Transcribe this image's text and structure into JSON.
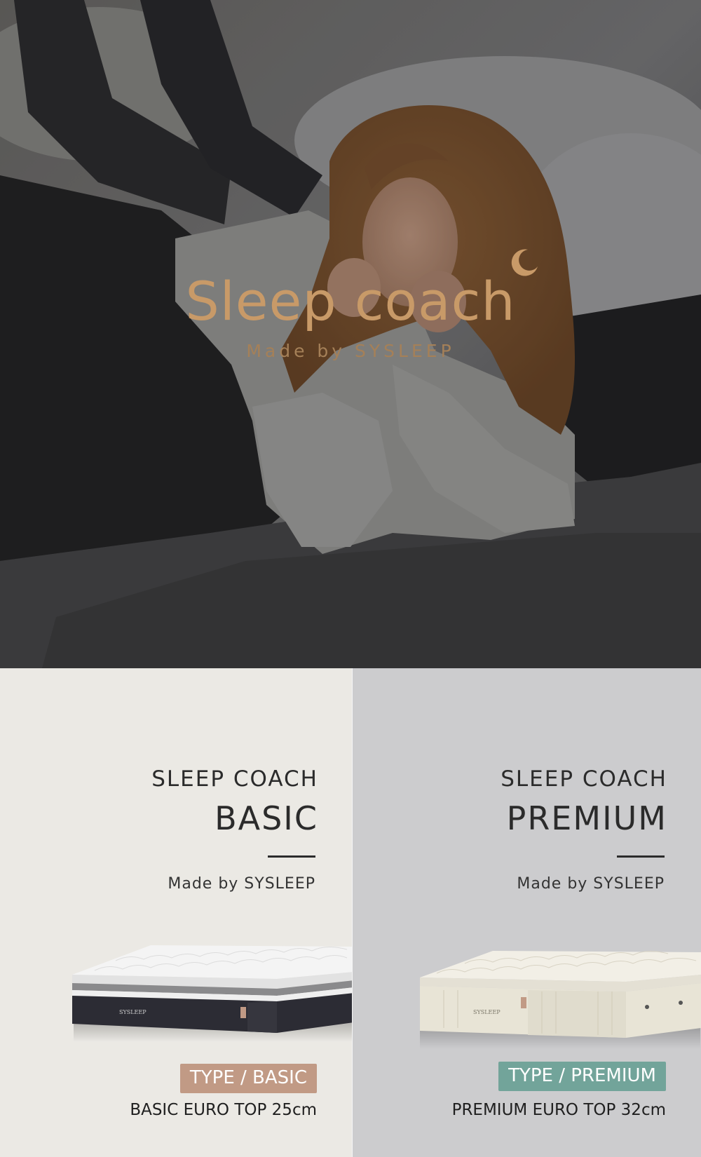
{
  "hero": {
    "title": "Sleep coach",
    "subtitle": "Made by SYSLEEP",
    "title_color": "#c89a68",
    "moon_icon": "crescent-moon-icon"
  },
  "products": [
    {
      "line1": "SLEEP COACH",
      "line2": "BASIC",
      "made_by": "Made by SYSLEEP",
      "mattress_logo": "SYSLEEP",
      "badge": "TYPE / BASIC",
      "badge_color": "#c19a85",
      "spec": "BASIC EURO TOP 25cm",
      "panel_color": "#ebe9e4"
    },
    {
      "line1": "SLEEP COACH",
      "line2": "PREMIUM",
      "made_by": "Made by SYSLEEP",
      "mattress_logo": "SYSLEEP",
      "badge": "TYPE / PREMIUM",
      "badge_color": "#72a49a",
      "spec": "PREMIUM EURO TOP 32cm",
      "panel_color": "#ccccce"
    }
  ]
}
